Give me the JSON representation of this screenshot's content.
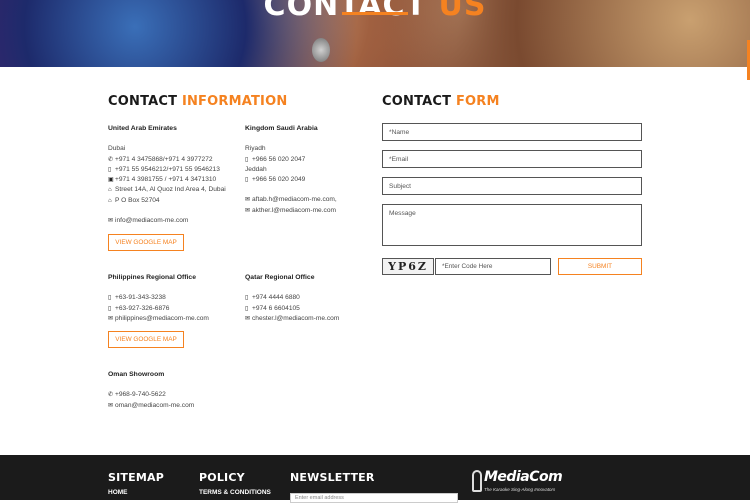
{
  "hero": {
    "title_part1": "CONTACT",
    "title_part2": "US"
  },
  "info_heading": {
    "part1": "CONTACT",
    "part2": "INFORMATION"
  },
  "form_heading": {
    "part1": "CONTACT",
    "part2": "FORM"
  },
  "offices": {
    "uae": {
      "name": "United Arab Emirates",
      "city": "Dubai",
      "tel": "+971 4 3475868/+971 4 3977272",
      "mobile": "+971 55 9546212/+971 55 9546213",
      "fax": "+971 4 3981755 / +971 4 3471310",
      "address": "Street 14A, Al Quoz Ind Area 4, Dubai",
      "pobox": "P O Box 52704",
      "email": "info@mediacom-me.com",
      "map_button": "VIEW GOOGLE MAP"
    },
    "ksa": {
      "name": "Kingdom Saudi Arabia",
      "city1": "Riyadh",
      "mobile1": "+966 56 020 2047",
      "city2": "Jeddah",
      "mobile2": "+966 56 020 2049",
      "email1": "aftab.h@mediacom-me.com,",
      "email2": "akther.l@mediacom-me.com"
    },
    "philippines": {
      "name": "Philippines Regional Office",
      "mobile1": "+63-91-343-3238",
      "mobile2": "+63-927-326-6876",
      "email": "philippines@mediacom-me.com",
      "map_button": "VIEW GOOGLE MAP"
    },
    "qatar": {
      "name": "Qatar Regional Office",
      "mobile1": "+974 4444 6880",
      "mobile2": "+974 6 6604105",
      "email": "chester.l@mediacom-me.com"
    },
    "oman": {
      "name": "Oman Showroom",
      "phone": "+968-9-740-5622",
      "email": "oman@mediacom-me.com"
    }
  },
  "form": {
    "name_placeholder": "*Name",
    "email_placeholder": "*Email",
    "subject_placeholder": "Subject",
    "message_placeholder": "Message",
    "captcha_text": "YP6Z",
    "captcha_placeholder": "*Enter Code Here",
    "submit_label": "SUBMIT"
  },
  "footer": {
    "sitemap_title": "SITEMAP",
    "sitemap_first": "HOME",
    "policy_title": "POLICY",
    "policy_first": "TERMS & CONDITIONS",
    "newsletter_title": "NEWSLETTER",
    "newsletter_placeholder": "Enter email address",
    "logo_brand": "MediaCom",
    "logo_tagline": "The Karaoke Sing-Along Innovators"
  },
  "colors": {
    "accent": "#f58220",
    "footer_bg": "#1b1b1b",
    "heading": "#1a1a1a"
  },
  "icons": [
    "phone-icon",
    "mobile-icon",
    "fax-icon",
    "home-icon",
    "pobox-icon",
    "email-icon"
  ]
}
